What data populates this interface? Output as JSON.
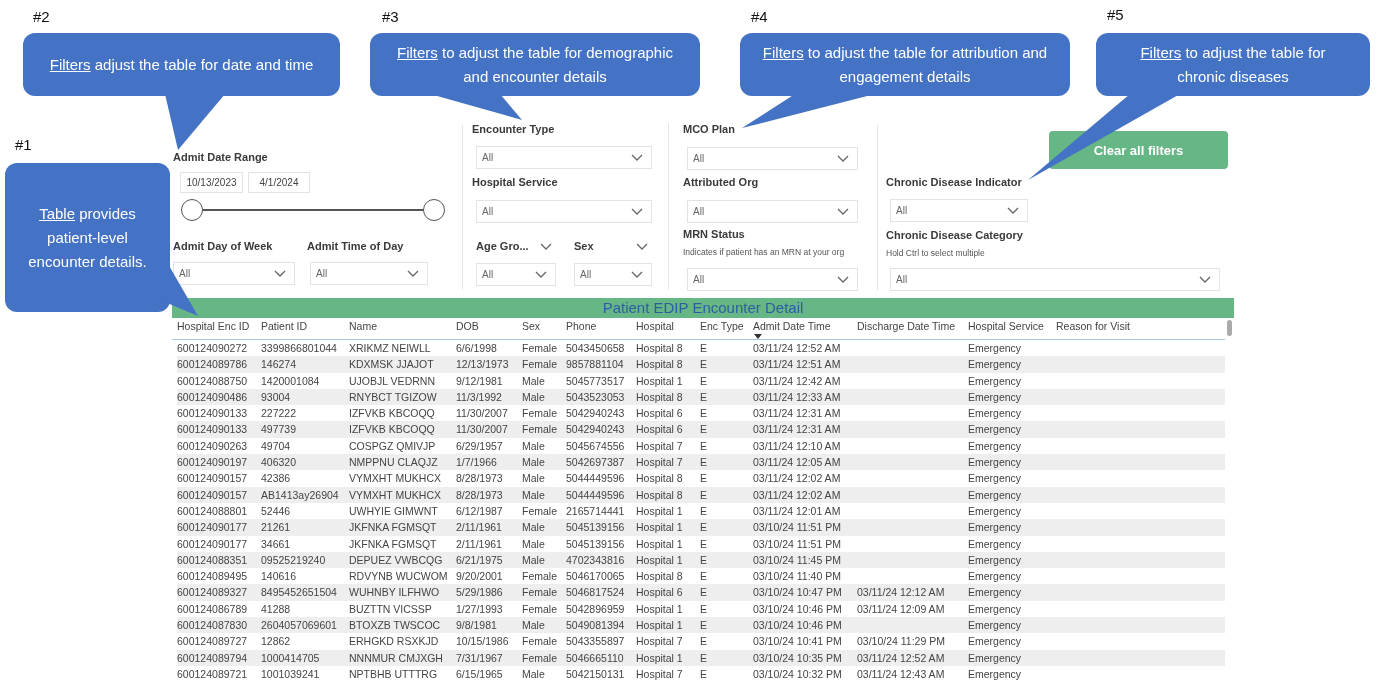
{
  "callouts": [
    {
      "number": "#2",
      "underlined": "Filters",
      "text": "adjust the table for date and time"
    },
    {
      "number": "#3",
      "underlined": "Filters",
      "text": "to adjust the table for demographic and encounter details"
    },
    {
      "number": "#4",
      "underlined": "Filters",
      "text": "to adjust the table for attribution and engagement details"
    },
    {
      "number": "#5",
      "underlined": "Filters",
      "text": "to adjust the table for chronic diseases"
    },
    {
      "number": "#1",
      "underlined": "Table",
      "text": "provides patient-level encounter details."
    }
  ],
  "date_range": {
    "label": "Admit Date Range",
    "start": "10/13/2023",
    "end": "4/1/2024",
    "thumbs": [
      {
        "level": 0
      },
      {
        "level": 1
      }
    ]
  },
  "slicers": [
    {
      "kind": "standard",
      "label": "Admit Day of Week",
      "value": "All"
    },
    {
      "kind": "standard",
      "label": "Admit Time of Day",
      "value": "All"
    },
    {
      "kind": "standard",
      "label": "Encounter Type",
      "value": "All"
    },
    {
      "kind": "standard",
      "label": "Hospital Service",
      "value": "All"
    },
    {
      "kind": "header",
      "label": "Age Gro...",
      "value": "All"
    },
    {
      "kind": "header",
      "label": "Sex",
      "value": "All"
    },
    {
      "kind": "standard",
      "label": "MCO Plan",
      "value": "All"
    },
    {
      "kind": "standard",
      "label": "Attributed Org",
      "value": "All"
    },
    {
      "kind": "standard",
      "label": "MRN Status",
      "note": "Indicates if patient has an MRN at your org",
      "value": "All"
    },
    {
      "kind": "standard",
      "label": "Chronic Disease Indicator",
      "value": "All"
    },
    {
      "kind": "standard",
      "label": "Chronic Disease Category",
      "note": "Hold Ctrl to select multiple",
      "value": "All"
    }
  ],
  "clear_button": {
    "label": "Clear all filters"
  },
  "table": {
    "title": "Patient EDIP Encounter Detail",
    "columns": [
      {
        "label": "Hospital Enc ID",
        "sorted": false
      },
      {
        "label": "Patient ID",
        "sorted": false
      },
      {
        "label": "Name",
        "sorted": false
      },
      {
        "label": "DOB",
        "sorted": false
      },
      {
        "label": "Sex",
        "sorted": false
      },
      {
        "label": "Phone",
        "sorted": false
      },
      {
        "label": "Hospital",
        "sorted": false
      },
      {
        "label": "Enc Type",
        "sorted": false
      },
      {
        "label": "Admit Date Time",
        "sorted": true
      },
      {
        "label": "Discharge Date Time",
        "sorted": false
      },
      {
        "label": "Hospital Service",
        "sorted": false
      },
      {
        "label": "Reason for Visit",
        "sorted": false
      }
    ],
    "rows": [
      {
        "enc_id": "600124090272",
        "patient_id": "3399866801044",
        "name": "XRIKMZ NEIWLL",
        "dob": "6/6/1998",
        "sex": "Female",
        "phone": "5043450658",
        "hospital": "Hospital 8",
        "enc_type": "E",
        "admit": "03/11/24 12:52 AM",
        "service": "Emergency"
      },
      {
        "enc_id": "600124089786",
        "patient_id": "146274",
        "name": "KDXMSK JJAJOT",
        "dob": "12/13/1973",
        "sex": "Female",
        "phone": "9857881104",
        "hospital": "Hospital 8",
        "enc_type": "E",
        "admit": "03/11/24 12:51 AM",
        "service": "Emergency"
      },
      {
        "enc_id": "600124088750",
        "patient_id": "1420001084",
        "name": "UJOBJL VEDRNN",
        "dob": "9/12/1981",
        "sex": "Male",
        "phone": "5045773517",
        "hospital": "Hospital 1",
        "enc_type": "E",
        "admit": "03/11/24 12:42 AM",
        "service": "Emergency"
      },
      {
        "enc_id": "600124090486",
        "patient_id": "93004",
        "name": "RNYBCT TGIZOW",
        "dob": "11/3/1992",
        "sex": "Male",
        "phone": "5043523053",
        "hospital": "Hospital 8",
        "enc_type": "E",
        "admit": "03/11/24 12:33 AM",
        "service": "Emergency"
      },
      {
        "enc_id": "600124090133",
        "patient_id": "227222",
        "name": "IZFVKB KBCOQQ",
        "dob": "11/30/2007",
        "sex": "Female",
        "phone": "5042940243",
        "hospital": "Hospital 6",
        "enc_type": "E",
        "admit": "03/11/24 12:31 AM",
        "service": "Emergency"
      },
      {
        "enc_id": "600124090133",
        "patient_id": "497739",
        "name": "IZFVKB KBCOQQ",
        "dob": "11/30/2007",
        "sex": "Female",
        "phone": "5042940243",
        "hospital": "Hospital 6",
        "enc_type": "E",
        "admit": "03/11/24 12:31 AM",
        "service": "Emergency"
      },
      {
        "enc_id": "600124090263",
        "patient_id": "49704",
        "name": "COSPGZ QMIVJP",
        "dob": "6/29/1957",
        "sex": "Male",
        "phone": "5045674556",
        "hospital": "Hospital 7",
        "enc_type": "E",
        "admit": "03/11/24 12:10 AM",
        "service": "Emergency"
      },
      {
        "enc_id": "600124090197",
        "patient_id": "406320",
        "name": "NMPPNU CLAQJZ",
        "dob": "1/7/1966",
        "sex": "Male",
        "phone": "5042697387",
        "hospital": "Hospital 7",
        "enc_type": "E",
        "admit": "03/11/24 12:05 AM",
        "service": "Emergency"
      },
      {
        "enc_id": "600124090157",
        "patient_id": "42386",
        "name": "VYMXHT MUKHCX",
        "dob": "8/28/1973",
        "sex": "Male",
        "phone": "5044449596",
        "hospital": "Hospital 8",
        "enc_type": "E",
        "admit": "03/11/24 12:02 AM",
        "service": "Emergency"
      },
      {
        "enc_id": "600124090157",
        "patient_id": "AB1413ay26904",
        "name": "VYMXHT MUKHCX",
        "dob": "8/28/1973",
        "sex": "Male",
        "phone": "5044449596",
        "hospital": "Hospital 8",
        "enc_type": "E",
        "admit": "03/11/24 12:02 AM",
        "service": "Emergency"
      },
      {
        "enc_id": "600124088801",
        "patient_id": "52446",
        "name": "UWHYIE GIMWNT",
        "dob": "6/12/1987",
        "sex": "Female",
        "phone": "2165714441",
        "hospital": "Hospital 1",
        "enc_type": "E",
        "admit": "03/11/24 12:01 AM",
        "service": "Emergency"
      },
      {
        "enc_id": "600124090177",
        "patient_id": "21261",
        "name": "JKFNKA FGMSQT",
        "dob": "2/11/1961",
        "sex": "Male",
        "phone": "5045139156",
        "hospital": "Hospital 1",
        "enc_type": "E",
        "admit": "03/10/24 11:51 PM",
        "service": "Emergency"
      },
      {
        "enc_id": "600124090177",
        "patient_id": "34661",
        "name": "JKFNKA FGMSQT",
        "dob": "2/11/1961",
        "sex": "Male",
        "phone": "5045139156",
        "hospital": "Hospital 1",
        "enc_type": "E",
        "admit": "03/10/24 11:51 PM",
        "service": "Emergency"
      },
      {
        "enc_id": "600124088351",
        "patient_id": "09525219240",
        "name": "DEPUEZ VWBCQG",
        "dob": "6/21/1975",
        "sex": "Male",
        "phone": "4702343816",
        "hospital": "Hospital 1",
        "enc_type": "E",
        "admit": "03/10/24 11:45 PM",
        "service": "Emergency"
      },
      {
        "enc_id": "600124089495",
        "patient_id": "140616",
        "name": "RDVYNB WUCWOM",
        "dob": "9/20/2001",
        "sex": "Female",
        "phone": "5046170065",
        "hospital": "Hospital 8",
        "enc_type": "E",
        "admit": "03/10/24 11:40 PM",
        "service": "Emergency"
      },
      {
        "enc_id": "600124089327",
        "patient_id": "8495452651504",
        "name": "WUHNBY ILFHWO",
        "dob": "5/29/1986",
        "sex": "Female",
        "phone": "5046817524",
        "hospital": "Hospital 6",
        "enc_type": "E",
        "admit": "03/10/24 10:47 PM",
        "discharge": "03/11/24 12:12 AM",
        "service": "Emergency"
      },
      {
        "enc_id": "600124086789",
        "patient_id": "41288",
        "name": "BUZTTN VICSSP",
        "dob": "1/27/1993",
        "sex": "Female",
        "phone": "5042896959",
        "hospital": "Hospital 1",
        "enc_type": "E",
        "admit": "03/10/24 10:46 PM",
        "discharge": "03/11/24 12:09 AM",
        "service": "Emergency"
      },
      {
        "enc_id": "600124087830",
        "patient_id": "2604057069601",
        "name": "BTOXZB TWSCOC",
        "dob": "9/8/1981",
        "sex": "Male",
        "phone": "5049081394",
        "hospital": "Hospital 1",
        "enc_type": "E",
        "admit": "03/10/24 10:46 PM",
        "service": "Emergency"
      },
      {
        "enc_id": "600124089727",
        "patient_id": "12862",
        "name": "ERHGKD RSXKJD",
        "dob": "10/15/1986",
        "sex": "Female",
        "phone": "5043355897",
        "hospital": "Hospital 7",
        "enc_type": "E",
        "admit": "03/10/24 10:41 PM",
        "discharge": "03/10/24 11:29 PM",
        "service": "Emergency"
      },
      {
        "enc_id": "600124089794",
        "patient_id": "1000414705",
        "name": "NNNMUR CMJXGH",
        "dob": "7/31/1967",
        "sex": "Female",
        "phone": "5046665110",
        "hospital": "Hospital 1",
        "enc_type": "E",
        "admit": "03/10/24 10:35 PM",
        "discharge": "03/11/24 12:52 AM",
        "service": "Emergency"
      },
      {
        "enc_id": "600124089721",
        "patient_id": "1001039241",
        "name": "NPTBHB UTTTRG",
        "dob": "6/15/1965",
        "sex": "Male",
        "phone": "5042150131",
        "hospital": "Hospital 7",
        "enc_type": "E",
        "admit": "03/10/24 10:32 PM",
        "discharge": "03/11/24 12:43 AM",
        "service": "Emergency"
      }
    ]
  }
}
